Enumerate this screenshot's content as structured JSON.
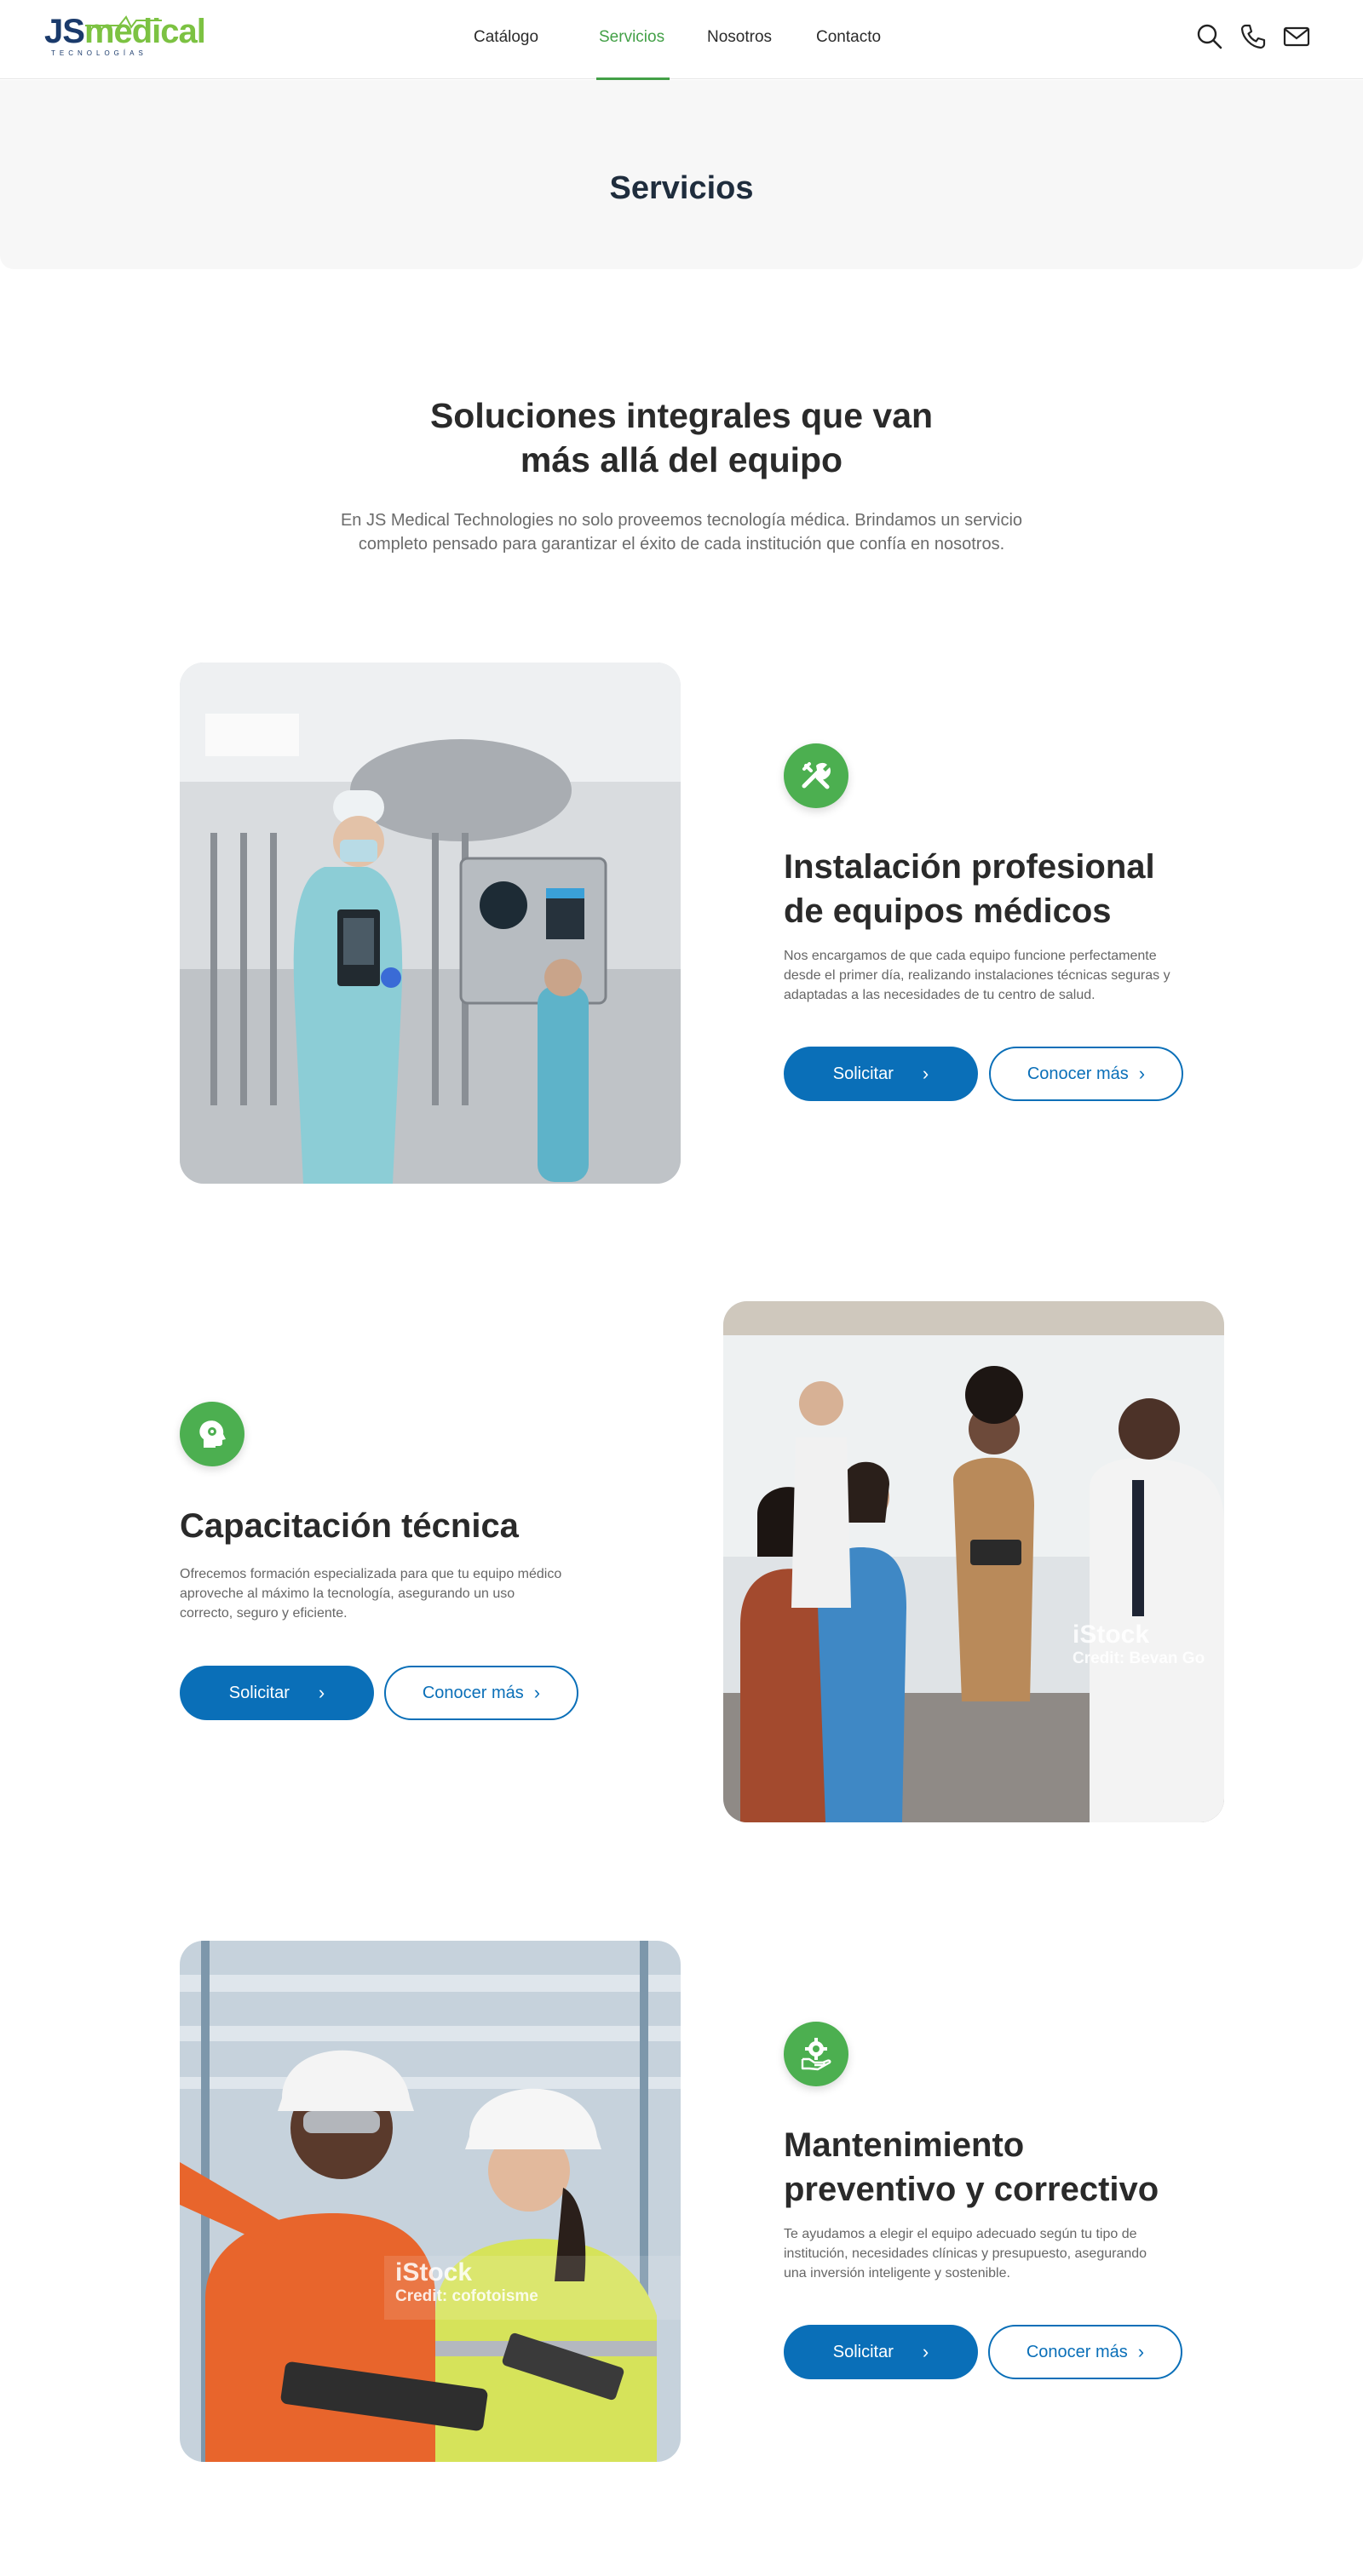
{
  "nav": {
    "logo": {
      "brand_js": "JS",
      "brand_medical": "medical",
      "tagline": "TECNOLOGÍAS"
    },
    "links": [
      {
        "label": "Catálogo"
      },
      {
        "label": "Servicios"
      },
      {
        "label": "Nosotros"
      },
      {
        "label": "Contacto"
      }
    ],
    "icons": [
      "search-icon",
      "phone-icon",
      "mail-icon"
    ],
    "active_color": "#43a047"
  },
  "banner": {
    "title": "Servicios"
  },
  "intro": {
    "title_line1": "Soluciones integrales que van",
    "title_line2": "más allá del equipo",
    "text_line1": "En JS Medical Technologies no solo proveemos tecnología médica. Brindamos un servicio",
    "text_line2": "completo pensado para garantizar el éxito de cada institución que confía en nosotros."
  },
  "services": [
    {
      "icon": "tools-icon",
      "title_line1": "Instalación profesional",
      "title_line2": "de equipos médicos",
      "text_line1": "Nos encargamos de que cada equipo funcione perfectamente",
      "text_line2": "desde el primer día, realizando instalaciones técnicas seguras y",
      "text_line3": "adaptadas a las necesidades de tu centro de salud.",
      "primary": "Solicitar",
      "secondary": "Conocer más"
    },
    {
      "icon": "head-gear-icon",
      "title_line1": "Capacitación técnica",
      "text_line1": "Ofrecemos formación especializada para que tu equipo médico",
      "text_line2": "aproveche al máximo la tecnología, asegurando un uso",
      "text_line3": "correcto, seguro y eficiente.",
      "primary": "Solicitar",
      "secondary": "Conocer más",
      "watermark_brand": "iStock",
      "watermark_credit": "Credit: Bevan Go"
    },
    {
      "icon": "hand-gear-icon",
      "title_line1": "Mantenimiento",
      "title_line2": "preventivo y correctivo",
      "text_line1": "Te ayudamos a elegir el equipo adecuado según tu tipo de",
      "text_line2": "institución, necesidades clínicas y presupuesto, asegurando",
      "text_line3": "una inversión inteligente y sostenible.",
      "primary": "Solicitar",
      "secondary": "Conocer más",
      "watermark_brand": "iStock",
      "watermark_credit": "Credit: cofotoisme"
    }
  ],
  "colors": {
    "primary_blue": "#0a6fb8",
    "icon_green": "#4caf50"
  }
}
